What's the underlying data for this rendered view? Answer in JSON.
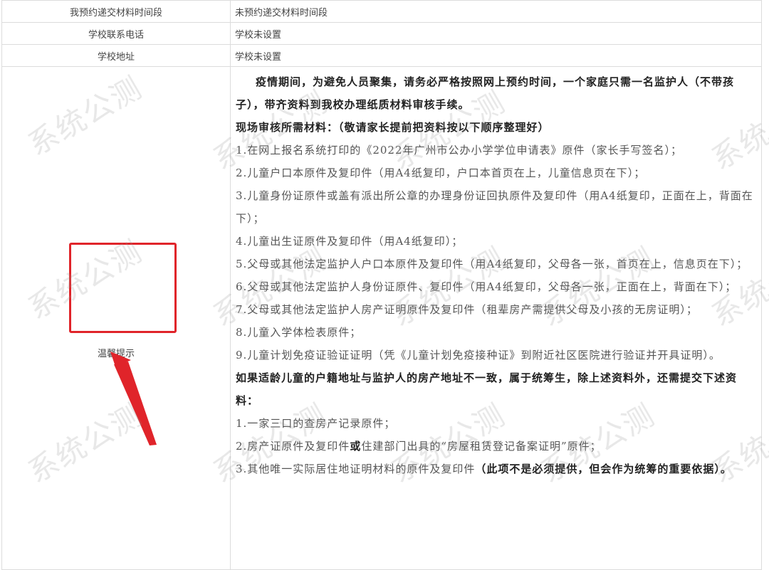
{
  "rows": [
    {
      "label": "我预约递交材料时间段",
      "value": "未预约递交材料时间段"
    },
    {
      "label": "学校联系电话",
      "value": "学校未设置"
    },
    {
      "label": "学校地址",
      "value": "学校未设置"
    }
  ],
  "notice": {
    "label": "温馨提示",
    "intro": "疫情期间，为避免人员聚集，请务必严格按照网上预约时间，一个家庭只需一名监护人（不带孩子），带齐资料到我校办理纸质材料审核手续。",
    "required_heading": "现场审核所需材料：（敬请家长提前把资料按以下顺序整理好）",
    "items": [
      "1.在网上报名系统打印的《2022年广州市公办小学学位申请表》原件（家长手写签名）；",
      "2.儿童户口本原件及复印件（用A4纸复印，户口本首页在上，儿童信息页在下）；",
      "3.儿童身份证原件或盖有派出所公章的办理身份证回执原件及复印件（用A4纸复印，正面在上，背面在下）；",
      "4.儿童出生证原件及复印件（用A4纸复印）；",
      "5.父母或其他法定监护人户口本原件及复印件（用A4纸复印，父母各一张，首页在上，信息页在下）；",
      "6.父母或其他法定监护人身份证原件、复印件（用A4纸复印，父母各一张，正面在上，背面在下）；",
      "7.父母或其他法定监护人房产证明原件及复印件（租辈房产需提供父母及小孩的无房证明）；",
      "8.儿童入学体检表原件；",
      "9.儿童计划免疫证验证证明（凭《儿童计划免疫接种证》到附近社区医院进行验证并开具证明）。"
    ],
    "extra_heading": "如果适龄儿童的户籍地址与监护人的房产地址不一致，属于统筹生，除上述资料外，还需提交下述资料：",
    "extra_items": [
      {
        "text": "1.一家三口的查房产记录原件；"
      },
      {
        "pre": "2.房产证原件及复印件",
        "bold": "或",
        "post": "住建部门出具的“房屋租赁登记备案证明”原件；"
      },
      {
        "pre": "3.其他唯一实际居住地证明材料的原件及复印件",
        "bold": "（此项不是必须提供，但会作为统筹的重要依据）。"
      }
    ]
  },
  "watermark_text": "系统公测",
  "colors": {
    "highlight": "#e0242a",
    "border": "#dcdcdc"
  }
}
